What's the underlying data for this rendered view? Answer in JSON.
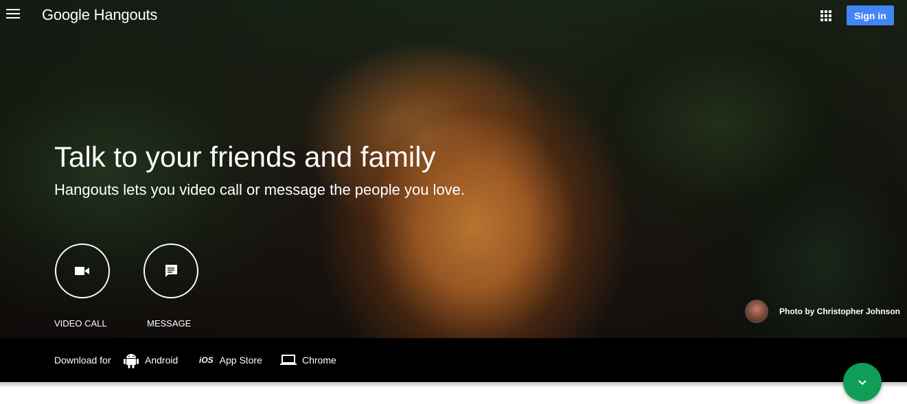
{
  "header": {
    "logo_text": "Google Hangouts",
    "signin_label": "Sign in",
    "signin_color": "#4285f4"
  },
  "hero": {
    "headline": "Talk to your friends and family",
    "subhead": "Hangouts lets you video call or message the people you love.",
    "actions": [
      {
        "label": "VIDEO CALL",
        "icon": "video-camera-icon"
      },
      {
        "label": "MESSAGE",
        "icon": "message-icon"
      }
    ],
    "photo_credit": "Photo by Christopher Johnson"
  },
  "download_bar": {
    "label": "Download for",
    "items": [
      {
        "label": "Android",
        "icon": "android-icon"
      },
      {
        "label": "App Store",
        "icon": "ios-icon",
        "icon_text": "iOS"
      },
      {
        "label": "Chrome",
        "icon": "laptop-icon"
      }
    ]
  },
  "fab": {
    "icon": "chevron-down-icon",
    "color": "#0f9d58"
  }
}
